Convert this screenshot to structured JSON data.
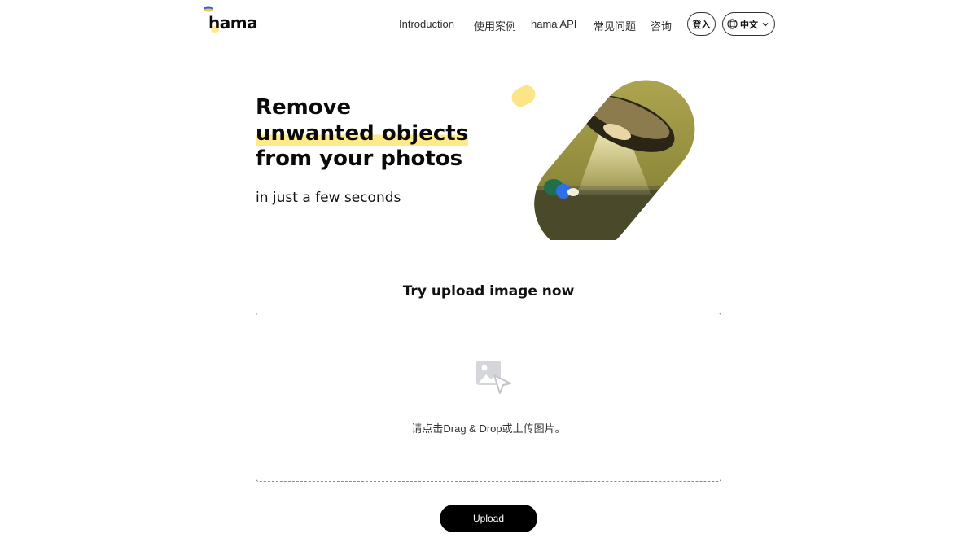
{
  "brand": {
    "name": "hama",
    "accent_color": "#ffe989",
    "logo_icon": "ufo-icon"
  },
  "nav": {
    "items": [
      {
        "label": "Introduction"
      },
      {
        "label": "使用案例"
      },
      {
        "label": "hama API"
      },
      {
        "label": "常见问题"
      },
      {
        "label": "咨询"
      }
    ],
    "login_label": "登入",
    "language_label": "中文",
    "language_icon": "globe-icon"
  },
  "hero": {
    "title_line1": "Remove",
    "title_line2": "unwanted objects",
    "title_line3": "from your photos",
    "subtitle": "in just a few seconds"
  },
  "upload": {
    "heading": "Try upload image now",
    "dropzone_text": "请点击Drag & Drop或上传图片。",
    "dropzone_icon": "image-upload-icon",
    "button_label": "Upload"
  }
}
